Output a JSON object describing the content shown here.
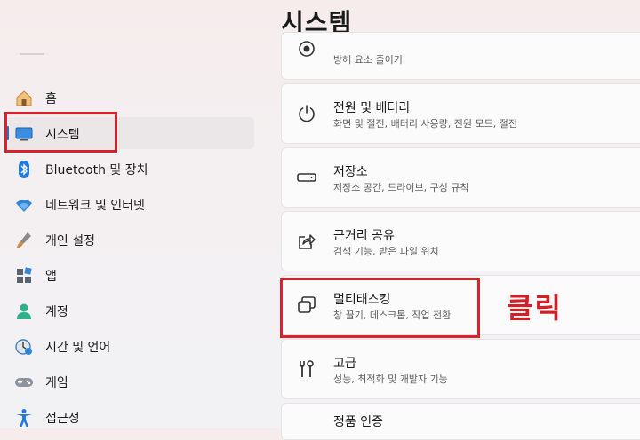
{
  "page": {
    "title": "시스템"
  },
  "sidebar": {
    "items": [
      {
        "label": "홈",
        "icon": "home-icon"
      },
      {
        "label": "시스템",
        "icon": "system-monitor-icon",
        "selected": true
      },
      {
        "label": "Bluetooth 및 장치",
        "icon": "bluetooth-icon"
      },
      {
        "label": "네트워크 및 인터넷",
        "icon": "wifi-icon"
      },
      {
        "label": "개인 설정",
        "icon": "brush-icon"
      },
      {
        "label": "앱",
        "icon": "apps-icon"
      },
      {
        "label": "계정",
        "icon": "account-icon"
      },
      {
        "label": "시간 및 언어",
        "icon": "time-language-icon"
      },
      {
        "label": "게임",
        "icon": "gamepad-icon"
      },
      {
        "label": "접근성",
        "icon": "accessibility-icon"
      }
    ]
  },
  "main": {
    "cards": [
      {
        "title": "",
        "desc": "방해 요소 줄이기",
        "icon": "focus-icon"
      },
      {
        "title": "전원 및 배터리",
        "desc": "화면 및 절전, 배터리 사용량, 전원 모드, 절전",
        "icon": "power-icon"
      },
      {
        "title": "저장소",
        "desc": "저장소 공간, 드라이브, 구성 규칙",
        "icon": "storage-icon"
      },
      {
        "title": "근거리 공유",
        "desc": "검색 기능, 받은 파일 위치",
        "icon": "share-icon"
      },
      {
        "title": "멀티태스킹",
        "desc": "창 끌기, 데스크톱, 작업 전환",
        "icon": "multitasking-icon"
      },
      {
        "title": "고급",
        "desc": "성능, 최적화 및 개발자 기능",
        "icon": "advanced-tools-icon"
      },
      {
        "title": "정품 인증",
        "desc": "",
        "icon": "activation-icon"
      }
    ]
  },
  "annotation": {
    "text": "클릭",
    "color": "#d8232a"
  }
}
